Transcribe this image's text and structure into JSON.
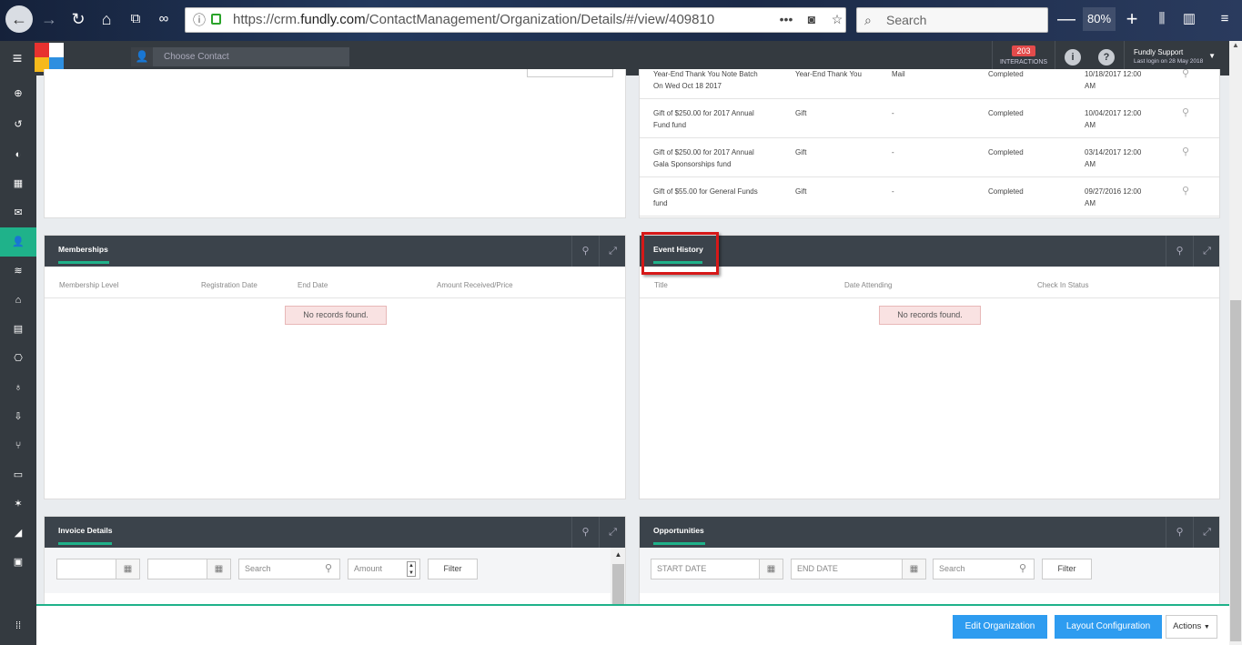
{
  "browser": {
    "url_prefix": "https://crm.",
    "url_domain": "fundly.com",
    "url_path": "/ContactManagement/Organization/Details/#/view/409810",
    "url_more": "•••",
    "search_placeholder": "Search",
    "zoom_level": "80%",
    "zoom_minus": "—",
    "zoom_plus": "+"
  },
  "header": {
    "choose_contact": "Choose Contact",
    "interactions_count": "203",
    "interactions_label": "INTERACTIONS",
    "info_icon": "i",
    "help_icon": "?",
    "user_name": "Fundly Support",
    "last_login": "Last login on 28 May 2018"
  },
  "gifts": {
    "rows": [
      {
        "desc1": "Year-End Thank You Note Batch",
        "desc2": "On Wed Oct 18 2017",
        "type": "Year-End Thank You",
        "ref": "Mail",
        "status": "Completed",
        "date1": "10/18/2017 12:00",
        "date2": "AM"
      },
      {
        "desc1": "Gift of $250.00 for 2017 Annual",
        "desc2": "Fund fund",
        "type": "Gift",
        "ref": "-",
        "status": "Completed",
        "date1": "10/04/2017 12:00",
        "date2": "AM"
      },
      {
        "desc1": "Gift of $250.00 for 2017 Annual",
        "desc2": "Gala Sponsorships fund",
        "type": "Gift",
        "ref": "-",
        "status": "Completed",
        "date1": "03/14/2017 12:00",
        "date2": "AM"
      },
      {
        "desc1": "Gift of $55.00 for General Funds",
        "desc2": "fund",
        "type": "Gift",
        "ref": "-",
        "status": "Completed",
        "date1": "09/27/2016 12:00",
        "date2": "AM"
      }
    ]
  },
  "memberships": {
    "title": "Memberships",
    "columns": [
      "Membership Level",
      "Registration Date",
      "End Date",
      "Amount Received/Price"
    ],
    "empty": "No records found."
  },
  "event_history": {
    "title": "Event History",
    "columns": [
      "Title",
      "Date Attending",
      "Check In Status"
    ],
    "empty": "No records found."
  },
  "invoice_details": {
    "title": "Invoice Details",
    "search_placeholder": "Search",
    "amount_placeholder": "Amount",
    "filter_label": "Filter"
  },
  "opportunities": {
    "title": "Opportunities",
    "start_date_placeholder": "START DATE",
    "end_date_placeholder": "END DATE",
    "search_placeholder": "Search",
    "filter_label": "Filter"
  },
  "footer": {
    "edit_org": "Edit Organization",
    "layout_config": "Layout Configuration",
    "actions": "Actions"
  },
  "colors": {
    "accent": "#1fb28a",
    "header_bg": "#343a40",
    "primary_button": "#2e9cf0",
    "highlight": "#d61818"
  }
}
